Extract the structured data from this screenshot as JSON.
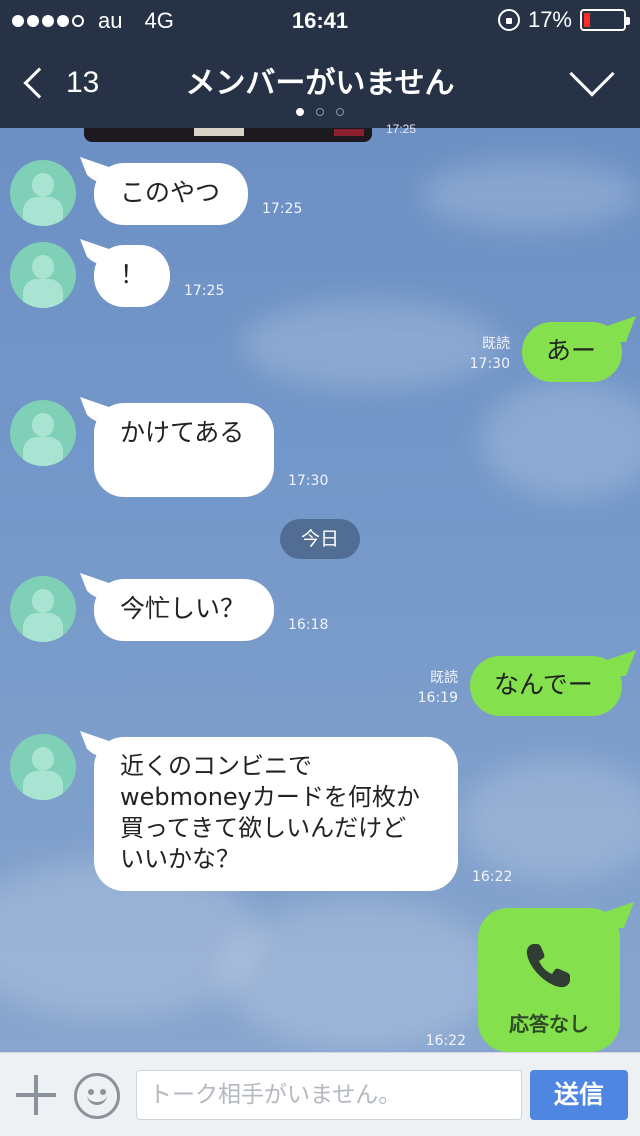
{
  "status_bar": {
    "carrier": "au",
    "network": "4G",
    "time": "16:41",
    "battery_text": "17%",
    "battery_level": 0.17,
    "signal_dots_filled": 4,
    "signal_dots_total": 5
  },
  "nav": {
    "back_count": "13",
    "title": "メンバーがいません",
    "page_dots_total": 3,
    "page_dots_active": 1
  },
  "messages": [
    {
      "side": "partial-image",
      "time": "17:25"
    },
    {
      "side": "left",
      "text": "このやつ",
      "time": "17:25"
    },
    {
      "side": "left",
      "text": "！",
      "time": "17:25"
    },
    {
      "side": "right",
      "text": "あー",
      "read": "既読",
      "time": "17:30"
    },
    {
      "side": "left",
      "text": "かけてある",
      "time": "17:30"
    },
    {
      "side": "date",
      "text": "今日"
    },
    {
      "side": "left",
      "text": "今忙しい？",
      "time": "16:18"
    },
    {
      "side": "right",
      "text": "なんでー",
      "read": "既読",
      "time": "16:19"
    },
    {
      "side": "left",
      "text": "近くのコンビニで\nwebmoneyカードを何枚か\n買ってきて欲しいんだけど\nいいかな？",
      "time": "16:22"
    },
    {
      "side": "right-call",
      "text": "応答なし",
      "time": "16:22"
    }
  ],
  "input_bar": {
    "placeholder": "トーク相手がいません。",
    "send_label": "送信"
  },
  "colors": {
    "header_bg": "#273246",
    "sent_bubble": "#84e04c",
    "received_bubble": "#ffffff",
    "send_button": "#4e86e2",
    "avatar": "#7fd0b6"
  },
  "icons": [
    "back-chevron-icon",
    "lock-rotation-icon",
    "battery-icon",
    "menu-chevron-icon",
    "avatar-icon",
    "phone-icon",
    "plus-icon",
    "emoji-icon"
  ]
}
